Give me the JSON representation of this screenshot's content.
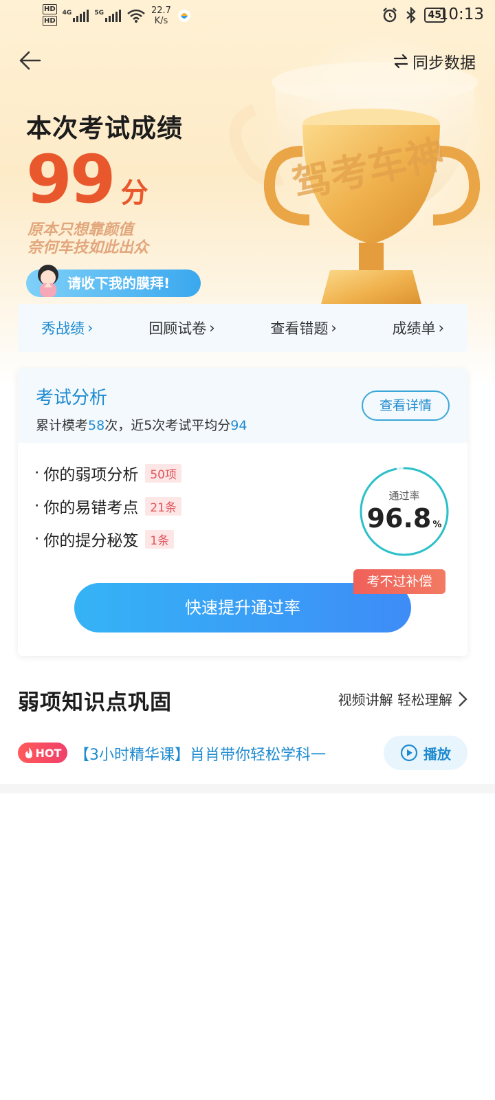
{
  "status_bar": {
    "hd1": "HD",
    "hd2": "HD",
    "net_type1": "4G",
    "net_type2": "5G",
    "net_speed": "22.7",
    "net_unit": "K/s",
    "battery": "45",
    "time": "10:13"
  },
  "topbar": {
    "sync_label": "同步数据"
  },
  "result": {
    "title": "本次考试成绩",
    "score": "99",
    "score_unit": "分",
    "slogan_line1": "原本只想靠颜值",
    "slogan_line2": "奈何车技如此出众",
    "bow_label": "请收下我的膜拜!",
    "trophy_text": "驾考车神"
  },
  "actions": [
    {
      "label": "秀战绩"
    },
    {
      "label": "回顾试卷"
    },
    {
      "label": "查看错题"
    },
    {
      "label": "成绩单"
    }
  ],
  "analysis": {
    "title": "考试分析",
    "sub_prefix": "累计模考",
    "exam_count": "58",
    "sub_mid": "次，近5次考试平均分",
    "avg_score": "94",
    "detail_label": "查看详情",
    "items": [
      {
        "label": "你的弱项分析",
        "tag": "50项"
      },
      {
        "label": "你的易错考点",
        "tag": "21条"
      },
      {
        "label": "你的提分秘笈",
        "tag": "1条"
      }
    ],
    "pass_rate_label": "通过率",
    "pass_rate": "96.8",
    "pass_rate_unit": "%",
    "pass_rate_fraction": 0.968,
    "boost_label": "快速提升通过率",
    "compensation_label": "考不过补偿"
  },
  "weak_section": {
    "title": "弱项知识点巩固",
    "more_label": "视频讲解 轻松理解",
    "hot_label": "HOT",
    "course_title": "【3小时精华课】肖肖带你轻松学科一",
    "play_label": "播放"
  },
  "colors": {
    "accent_blue": "#1e8bd0",
    "score_orange": "#e8582c",
    "tag_red": "#e0555a"
  }
}
